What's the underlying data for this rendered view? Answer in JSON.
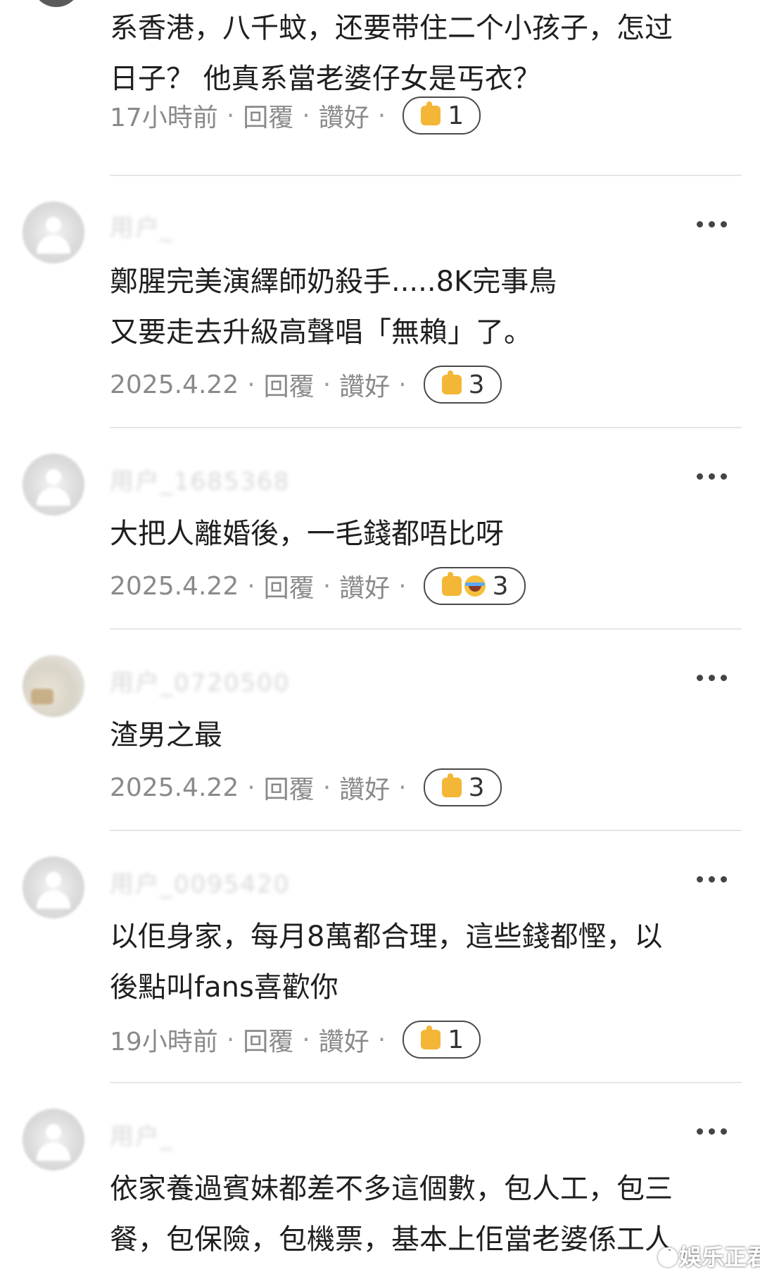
{
  "comments": [
    {
      "text": "系香港，八千蚊，还要带住二个小孩子，怎过\n日子？ 他真系當老婆仔女是丐衣？",
      "time": "17小時前",
      "reply": "回覆",
      "like": "讚好",
      "count": "1"
    },
    {
      "text": "鄭腥完美演繹師奶殺手.....8K完事鳥\n又要走去升級高聲唱「無賴」了。",
      "time": "2025.4.22",
      "reply": "回覆",
      "like": "讚好",
      "count": "3"
    },
    {
      "text": "大把人離婚後，一毛錢都唔比呀",
      "time": "2025.4.22",
      "reply": "回覆",
      "like": "讚好",
      "count": "3"
    },
    {
      "text": "渣男之最",
      "time": "2025.4.22",
      "reply": "回覆",
      "like": "讚好",
      "count": "3"
    },
    {
      "text": "以佢身家，每月8萬都合理，這些錢都慳，以\n後點叫fans喜歡你",
      "time": "19小時前",
      "reply": "回覆",
      "like": "讚好",
      "count": "1"
    },
    {
      "text": "依家養過賓妹都差不多這個數，包人工，包三\n餐，包保險，包機票，基本上佢當老婆係工人"
    }
  ],
  "usernames": [
    "用户_1685368",
    "用户_0720500",
    "用户_0095420"
  ],
  "watermark": "娛乐正君",
  "colors": {
    "meta": "#8a8a8a",
    "divider": "#e6e6e6",
    "text": "#1f1f1f",
    "reaction": "#f3b637"
  },
  "icons": [
    "thumbs-up-icon",
    "laughing-face-icon",
    "more-options-icon",
    "default-avatar-icon"
  ]
}
